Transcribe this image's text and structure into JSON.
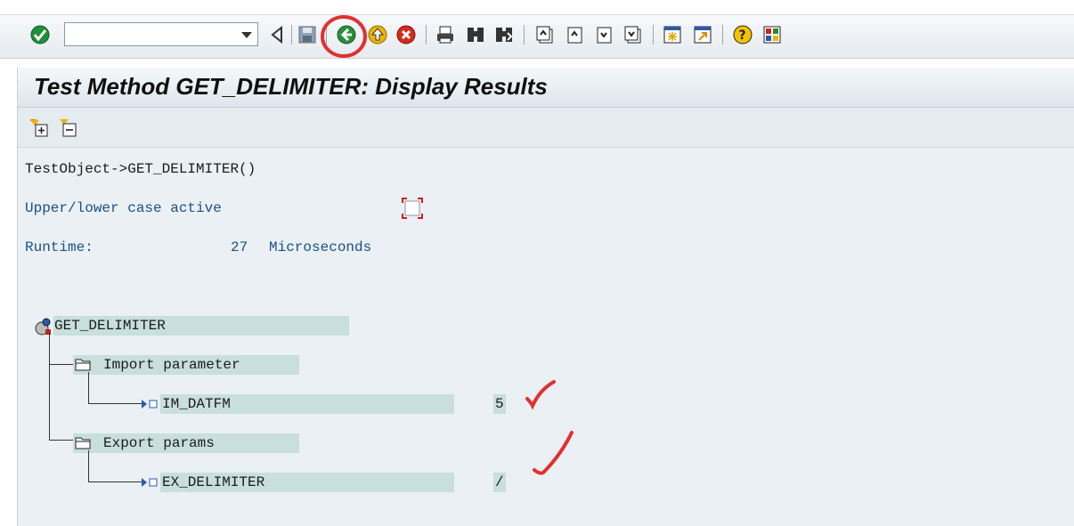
{
  "toolbar": {
    "command_field_value": "",
    "icons": [
      "enter-icon",
      "back-icon",
      "save-icon",
      "back-green-icon",
      "exit-icon",
      "cancel-icon",
      "print-icon",
      "find-icon",
      "find-next-icon",
      "first-page-icon",
      "previous-page-icon",
      "next-page-icon",
      "last-page-icon",
      "create-session-icon",
      "shortcut-icon",
      "help-icon",
      "customize-layout-icon"
    ],
    "accent_color": "#e03030"
  },
  "screen": {
    "title": "Test Method GET_DELIMITER: Display Results",
    "app_toolbar": {
      "icons": [
        "expand-all-icon",
        "collapse-all-icon"
      ]
    },
    "test_object": "TestObject->GET_DELIMITER()",
    "case_label": "Upper/lower case active",
    "case_checked": false,
    "runtime_label": "Runtime:",
    "runtime_value": "27",
    "runtime_unit": "Microseconds",
    "tree": {
      "root": "GET_DELIMITER",
      "import_label": "Import parameter",
      "import_param": "IM_DATFM",
      "import_value": "5",
      "export_label": "Export params",
      "export_param": "EX_DELIMITER",
      "export_value": "/"
    }
  }
}
